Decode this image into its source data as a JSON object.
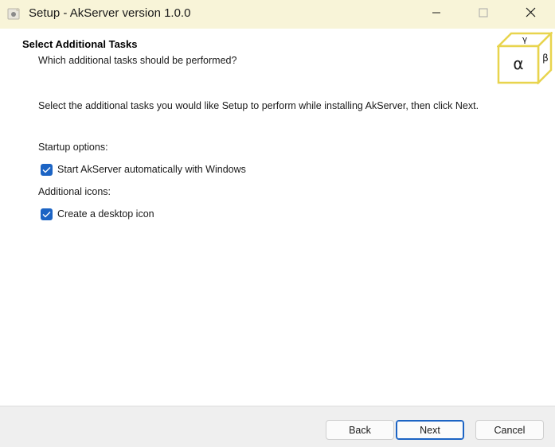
{
  "window": {
    "title": "Setup - AkServer version 1.0.0",
    "app_icon": "setup-icon"
  },
  "title_buttons": {
    "minimize_icon": "minimize-icon",
    "maximize_icon": "maximize-icon",
    "close_icon": "close-icon"
  },
  "header": {
    "title": "Select Additional Tasks",
    "subtitle": "Which additional tasks should be performed?",
    "logo": {
      "alpha": "α",
      "beta": "β",
      "gamma": "γ",
      "color": "#e8d44d"
    }
  },
  "body": {
    "instruction": "Select the additional tasks you would like Setup to perform while installing AkServer, then click Next.",
    "groups": [
      {
        "label": "Startup options:",
        "tasks": [
          {
            "label": "Start AkServer automatically with Windows",
            "checked": true
          }
        ]
      },
      {
        "label": "Additional icons:",
        "tasks": [
          {
            "label": "Create a desktop icon",
            "checked": true
          }
        ]
      }
    ]
  },
  "footer": {
    "back_label": "Back",
    "next_label": "Next",
    "cancel_label": "Cancel"
  },
  "colors": {
    "titlebar": "#f8f4d8",
    "accent": "#1c64c4",
    "footer": "#efefef"
  }
}
